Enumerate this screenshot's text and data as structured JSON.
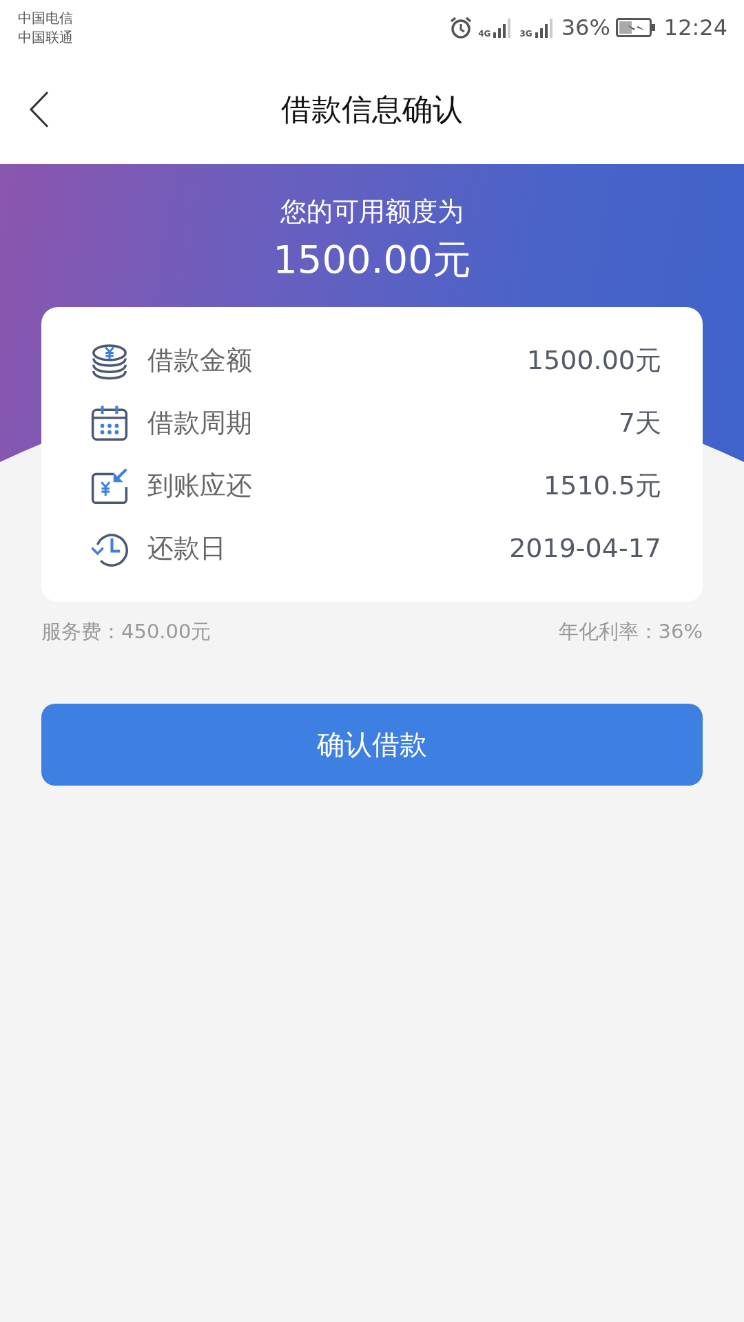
{
  "status_bar": {
    "carriers": [
      "中国电信",
      "中国联通"
    ],
    "network_1": "4G",
    "network_2": "3G",
    "battery": "36%",
    "time": "12:24"
  },
  "header": {
    "title": "借款信息确认"
  },
  "credit": {
    "label": "您的可用额度为",
    "amount": "1500.00元"
  },
  "details": [
    {
      "kind": "coins",
      "label": "借款金额",
      "value": "1500.00元"
    },
    {
      "kind": "calendar",
      "label": "借款周期",
      "value": "7天"
    },
    {
      "kind": "receive",
      "label": "到账应还",
      "value": "1510.5元"
    },
    {
      "kind": "history",
      "label": "还款日",
      "value": "2019-04-17"
    }
  ],
  "fees": {
    "service_fee": "服务费：450.00元",
    "annual_rate": "年化利率：36%"
  },
  "confirm_button": "确认借款"
}
